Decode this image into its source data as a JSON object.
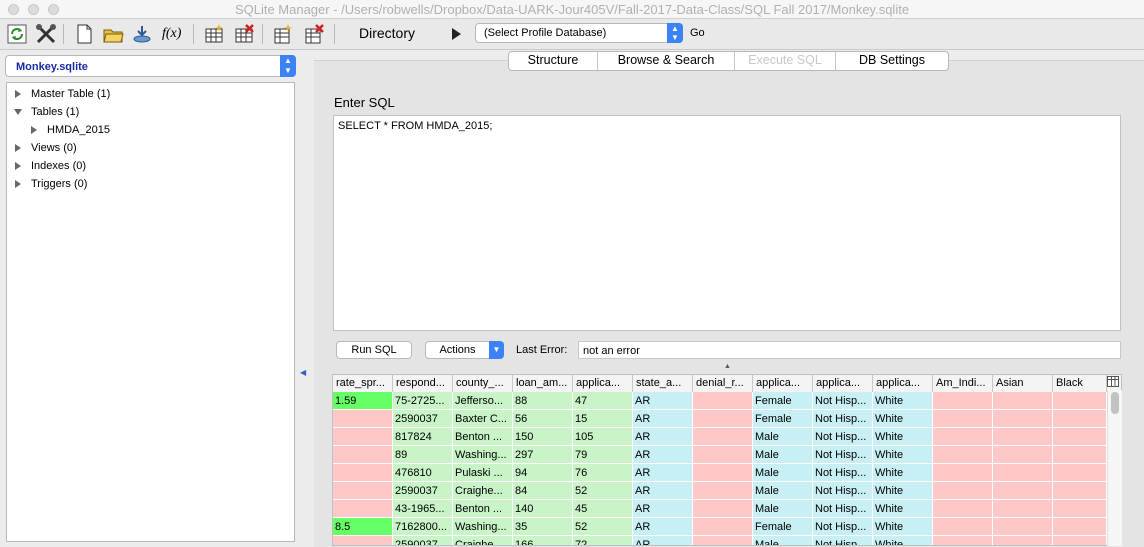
{
  "window": {
    "title": "SQLite Manager - /Users/robwells/Dropbox/Data-UARK-Jour405V/Fall-2017-Data-Class/SQL Fall 2017/Monkey.sqlite"
  },
  "toolbar": {
    "icons": [
      "refresh-icon",
      "tools-icon",
      "new-file-icon",
      "open-folder-icon",
      "connect-db-icon",
      "function-icon",
      "create-table-icon",
      "drop-table-icon",
      "create-index-icon",
      "drop-index-icon"
    ],
    "function_label": "f(x)",
    "directory_label": "Directory",
    "profile_select": "(Select Profile Database)",
    "go_label": "Go"
  },
  "sidebar": {
    "db_select": "Monkey.sqlite",
    "tree": [
      {
        "label": "Master Table (1)",
        "expanded": false,
        "level": 0
      },
      {
        "label": "Tables (1)",
        "expanded": true,
        "level": 0
      },
      {
        "label": "HMDA_2015",
        "expanded": false,
        "level": 1
      },
      {
        "label": "Views (0)",
        "expanded": false,
        "level": 0
      },
      {
        "label": "Indexes (0)",
        "expanded": false,
        "level": 0
      },
      {
        "label": "Triggers (0)",
        "expanded": false,
        "level": 0
      }
    ]
  },
  "tabs": [
    {
      "label": "Structure",
      "active": false
    },
    {
      "label": "Browse & Search",
      "active": false
    },
    {
      "label": "Execute SQL",
      "active": true
    },
    {
      "label": "DB Settings",
      "active": false
    }
  ],
  "sql": {
    "label": "Enter SQL",
    "query": "SELECT * FROM HMDA_2015;",
    "run_button": "Run SQL",
    "actions_button": "Actions",
    "last_error_label": "Last Error:",
    "last_error_value": "not an error"
  },
  "results": {
    "columns": [
      "rate_spr...",
      "respond...",
      "county_...",
      "loan_am...",
      "applica...",
      "state_a...",
      "denial_r...",
      "applica...",
      "applica...",
      "applica...",
      "Am_Indi...",
      "Asian",
      "Black"
    ],
    "column_colors": [
      "#ffc8c8",
      "#c8f4c8",
      "#c8f4c8",
      "#c8f4c8",
      "#c8f4c8",
      "#c8f0f4",
      "#ffc8c8",
      "#c8f0f4",
      "#c8f0f4",
      "#c8f0f4",
      "#ffc8c8",
      "#ffc8c8",
      "#ffc8c8"
    ],
    "highlight_color": "#66ff66",
    "rows": [
      [
        "1.59",
        "75-2725...",
        "Jefferso...",
        "88",
        "47",
        "AR",
        "",
        "Female",
        "Not Hisp...",
        "White",
        "",
        "",
        ""
      ],
      [
        "",
        "2590037",
        "Baxter C...",
        "56",
        "15",
        "AR",
        "",
        "Female",
        "Not Hisp...",
        "White",
        "",
        "",
        ""
      ],
      [
        "",
        "817824",
        "Benton ...",
        "150",
        "105",
        "AR",
        "",
        "Male",
        "Not Hisp...",
        "White",
        "",
        "",
        ""
      ],
      [
        "",
        "89",
        "Washing...",
        "297",
        "79",
        "AR",
        "",
        "Male",
        "Not Hisp...",
        "White",
        "",
        "",
        ""
      ],
      [
        "",
        "476810",
        "Pulaski ...",
        "94",
        "76",
        "AR",
        "",
        "Male",
        "Not Hisp...",
        "White",
        "",
        "",
        ""
      ],
      [
        "",
        "2590037",
        "Craighe...",
        "84",
        "52",
        "AR",
        "",
        "Male",
        "Not Hisp...",
        "White",
        "",
        "",
        ""
      ],
      [
        "",
        "43-1965...",
        "Benton ...",
        "140",
        "45",
        "AR",
        "",
        "Male",
        "Not Hisp...",
        "White",
        "",
        "",
        ""
      ],
      [
        "8.5",
        "7162800...",
        "Washing...",
        "35",
        "52",
        "AR",
        "",
        "Female",
        "Not Hisp...",
        "White",
        "",
        "",
        ""
      ],
      [
        "",
        "2590037",
        "Craighe...",
        "166",
        "72",
        "AR",
        "",
        "Male",
        "Not Hisp...",
        "White",
        "",
        "",
        ""
      ]
    ]
  }
}
